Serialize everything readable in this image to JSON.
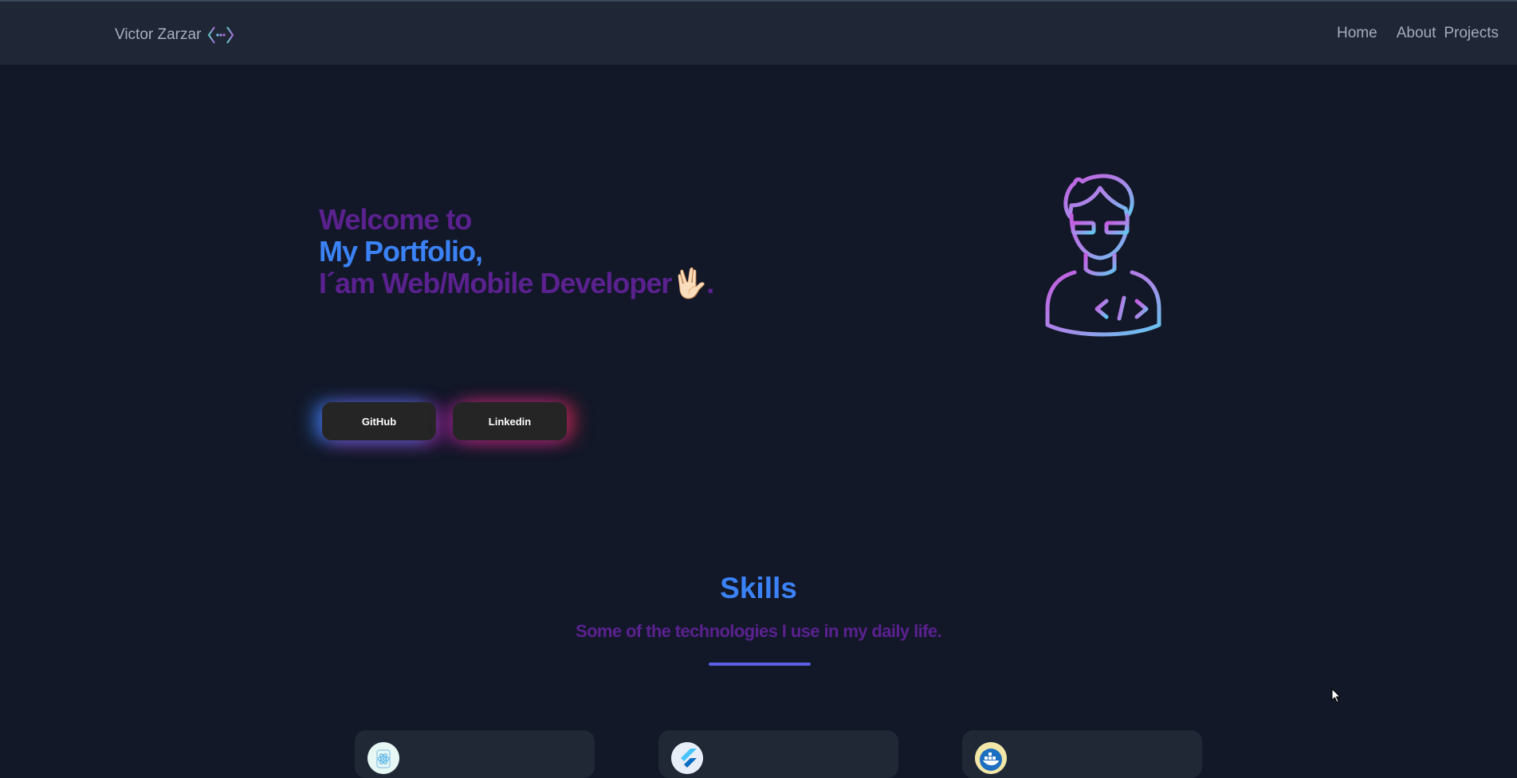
{
  "header": {
    "brand_name": "Victor Zarzar",
    "brand_icon": "code-brackets-icon",
    "nav": [
      {
        "label": "Home"
      },
      {
        "label": "About"
      },
      {
        "label": "Projects"
      }
    ]
  },
  "hero": {
    "line1": "Welcome to",
    "line2": "My Portfolio,",
    "line3": "I´am Web/Mobile Developer",
    "emoji": "🖖🏻",
    "line3_end": ".",
    "buttons": {
      "github": "GitHub",
      "linkedin": "Linkedin"
    },
    "illustration": "developer-avatar-icon"
  },
  "skills": {
    "title": "Skills",
    "subtitle": "Some of the technologies I use in my daily life.",
    "cards": [
      {
        "icon": "react-icon"
      },
      {
        "icon": "flutter-icon"
      },
      {
        "icon": "docker-icon"
      }
    ]
  },
  "colors": {
    "background": "#121828",
    "topbar": "#1f2736",
    "purple_text": "#5a218f",
    "blue_text": "#3b82f6",
    "divider": "#5b5fe6"
  }
}
